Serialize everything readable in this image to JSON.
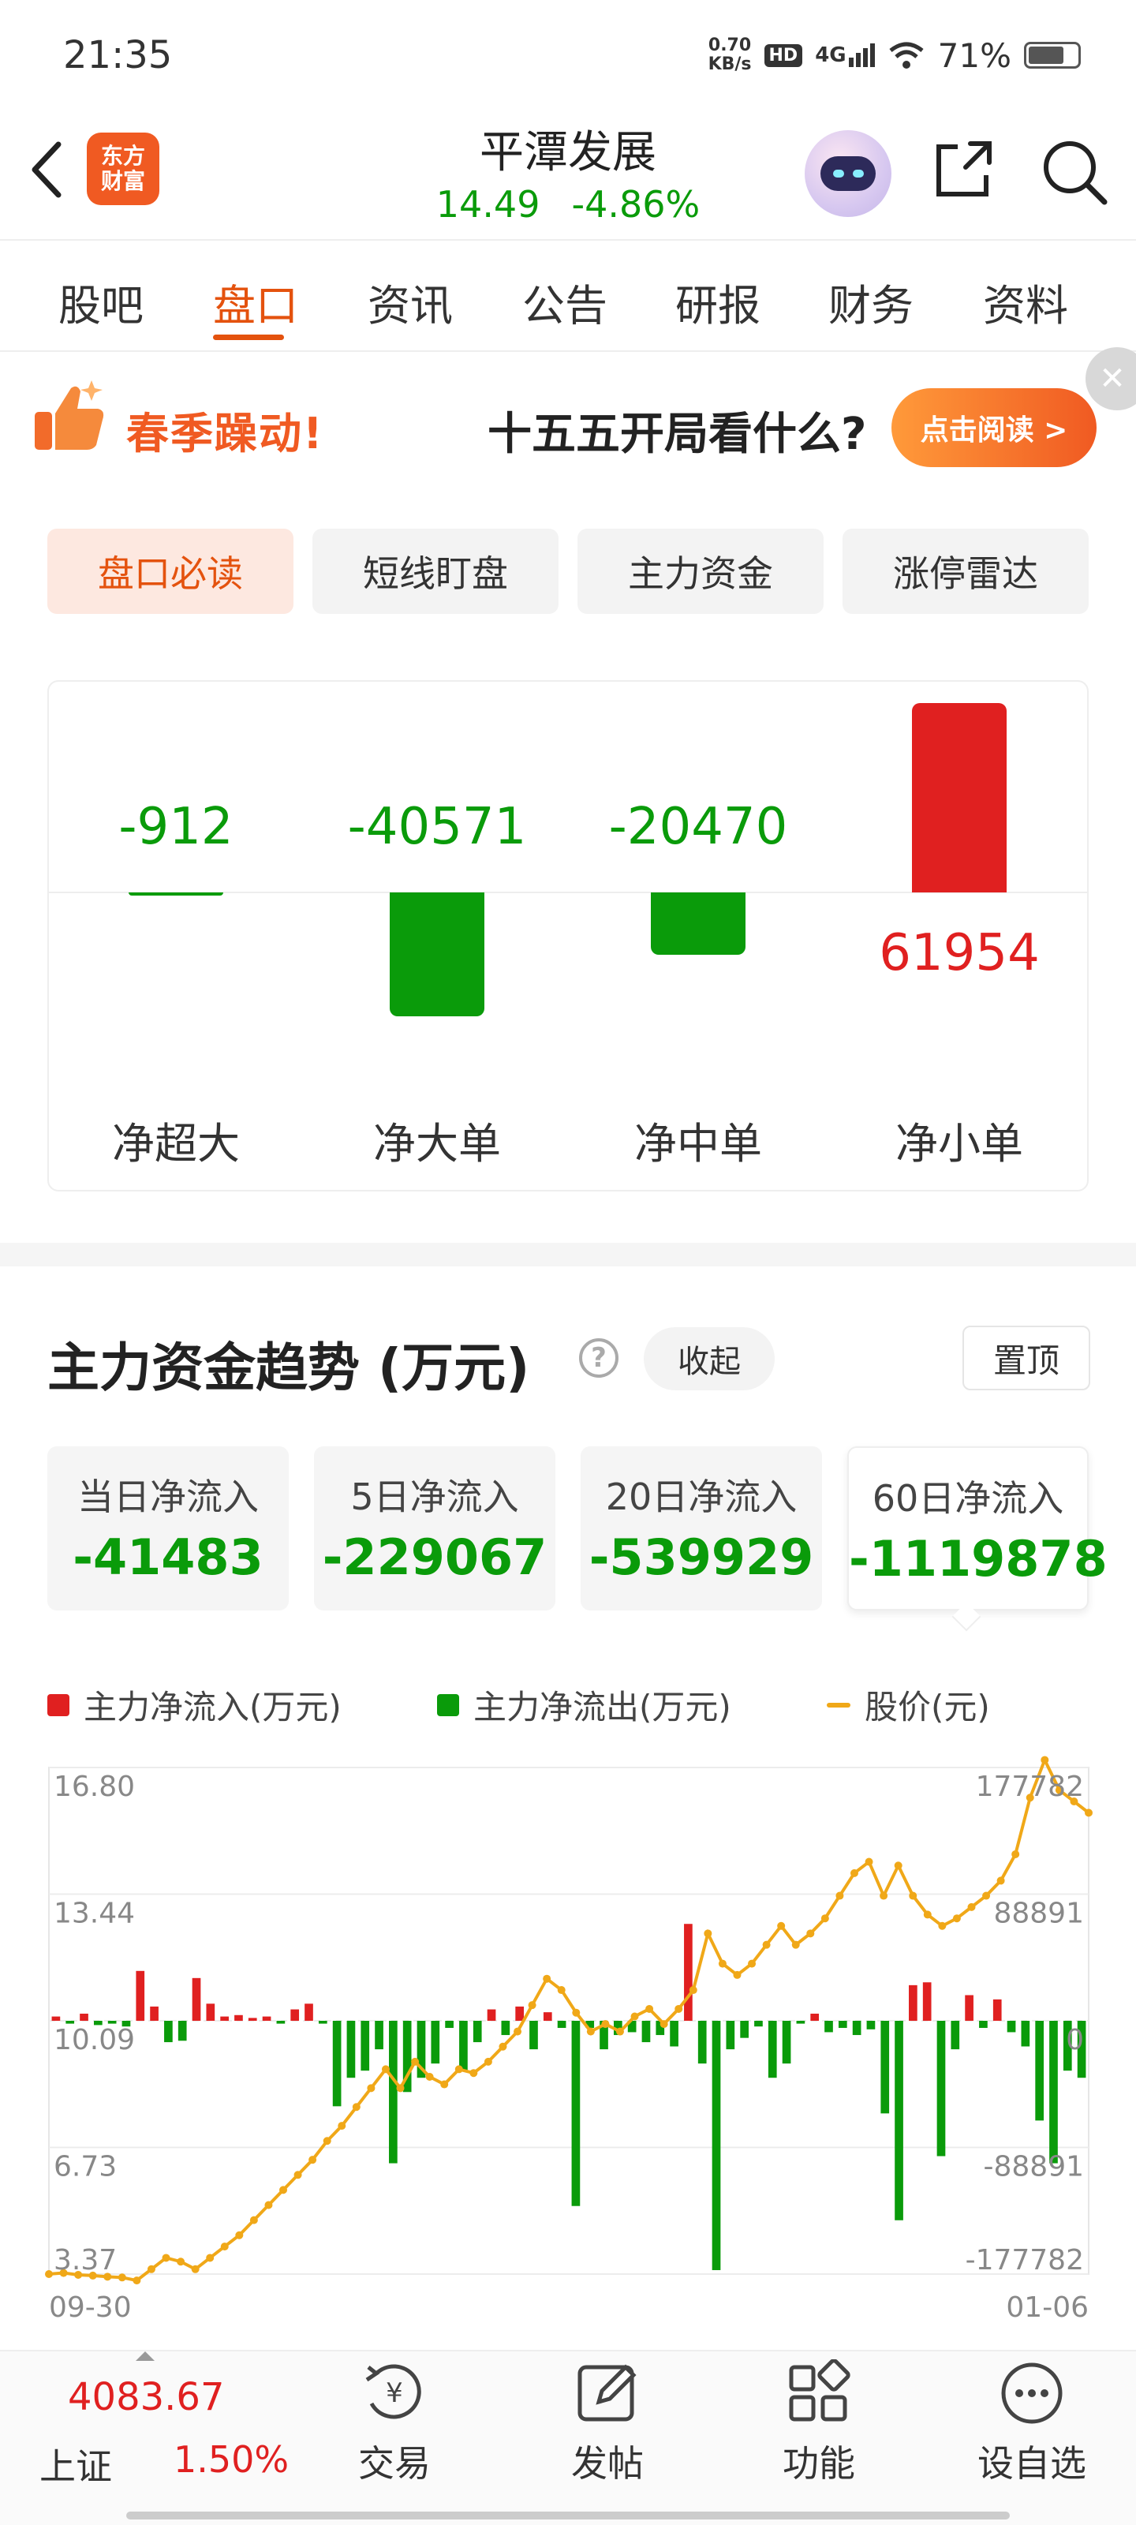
{
  "status_bar": {
    "time": "21:35",
    "net_speed_value": "0.70",
    "net_speed_unit": "KB/s",
    "hd": "HD",
    "network": "4G",
    "battery": "71%"
  },
  "header": {
    "logo_line1": "东方",
    "logo_line2": "财富",
    "stock_name": "平潭发展",
    "price": "14.49",
    "change": "-4.86%"
  },
  "tabs": [
    "股吧",
    "盘口",
    "资讯",
    "公告",
    "研报",
    "财务",
    "资料"
  ],
  "active_tab": "盘口",
  "banner": {
    "left_text": "春季躁动!",
    "middle_text": "十五五开局看什么?",
    "button_text": "点击阅读 >"
  },
  "subtabs": [
    "盘口必读",
    "短线盯盘",
    "主力资金",
    "涨停雷达"
  ],
  "flow": {
    "items": [
      {
        "label": "净超大",
        "value": "-912",
        "num": -912
      },
      {
        "label": "净大单",
        "value": "-40571",
        "num": -40571
      },
      {
        "label": "净中单",
        "value": "-20470",
        "num": -20470
      },
      {
        "label": "净小单",
        "value": "61954",
        "num": 61954
      }
    ]
  },
  "trend": {
    "title": "主力资金趋势 (万元)",
    "help": "?",
    "collapse_label": "收起",
    "pin_label": "置顶",
    "stats": [
      {
        "label": "当日净流入",
        "value": "-41483"
      },
      {
        "label": "5日净流入",
        "value": "-229067"
      },
      {
        "label": "20日净流入",
        "value": "-539929"
      },
      {
        "label": "60日净流入",
        "value": "-1119878"
      }
    ],
    "legend": [
      "主力净流入(万元)",
      "主力净流出(万元)",
      "股价(元)"
    ]
  },
  "chart_data": {
    "type": "bar+line",
    "x_start": "09-30",
    "x_end": "01-06",
    "left_axis_label": "股价(元)",
    "left_ticks": [
      "16.80",
      "13.44",
      "10.09",
      "6.73",
      "3.37"
    ],
    "left_range": [
      3.37,
      16.8
    ],
    "right_ticks": [
      "177782",
      "88891",
      "0",
      "-88891",
      "-177782"
    ],
    "right_range": [
      -177782,
      177782
    ],
    "colors": {
      "inflow": "#e02020",
      "outflow": "#0a9b0a",
      "price": "#f0a818"
    },
    "series": [
      {
        "name": "主力净流入(万元)/主力净流出(万元)",
        "values": [
          3000,
          -2000,
          5000,
          -3000,
          -2000,
          -4000,
          35000,
          10000,
          -15000,
          -14000,
          30000,
          12000,
          3000,
          4000,
          2000,
          3000,
          -2000,
          8000,
          12000,
          -2000,
          -60000,
          -40000,
          -35000,
          -20000,
          -100000,
          -50000,
          -40000,
          -30000,
          -5000,
          -35000,
          -15000,
          8000,
          -10000,
          10000,
          -20000,
          6000,
          -5000,
          -130000,
          -5000,
          -20000,
          -10000,
          -8000,
          -15000,
          -10000,
          -18000,
          68000,
          -30000,
          -175000,
          -20000,
          -12000,
          -4000,
          -40000,
          -30000,
          -2000,
          5000,
          -8000,
          -5000,
          -10000,
          -6000,
          -65000,
          -140000,
          25000,
          27000,
          -95000,
          -20000,
          18000,
          -5000,
          15000,
          -8000,
          -18000,
          -70000,
          -100000,
          -35000,
          -40000
        ],
        "axis": "right"
      },
      {
        "name": "股价(元)",
        "values": [
          3.37,
          3.4,
          3.35,
          3.33,
          3.3,
          3.28,
          3.2,
          3.5,
          3.8,
          3.7,
          3.5,
          3.8,
          4.1,
          4.4,
          4.8,
          5.2,
          5.6,
          6.0,
          6.4,
          6.9,
          7.3,
          7.8,
          8.3,
          8.8,
          8.3,
          9.0,
          8.6,
          8.4,
          8.8,
          8.7,
          9.0,
          9.4,
          9.8,
          10.5,
          11.2,
          10.9,
          10.3,
          9.8,
          10.0,
          9.8,
          10.2,
          10.4,
          10.0,
          10.4,
          10.9,
          12.4,
          11.6,
          11.3,
          11.6,
          12.1,
          12.6,
          12.1,
          12.4,
          12.8,
          13.4,
          14.0,
          14.3,
          13.4,
          14.2,
          13.4,
          12.9,
          12.6,
          12.8,
          13.1,
          13.4,
          13.8,
          14.5,
          16.0,
          17.0,
          16.2,
          15.9,
          15.6
        ],
        "axis": "left"
      }
    ]
  },
  "bottom_bar": {
    "index_value": "4083.67",
    "index_name": "上证",
    "index_change": "1.50%",
    "nav": [
      "交易",
      "发帖",
      "功能",
      "设自选"
    ]
  }
}
